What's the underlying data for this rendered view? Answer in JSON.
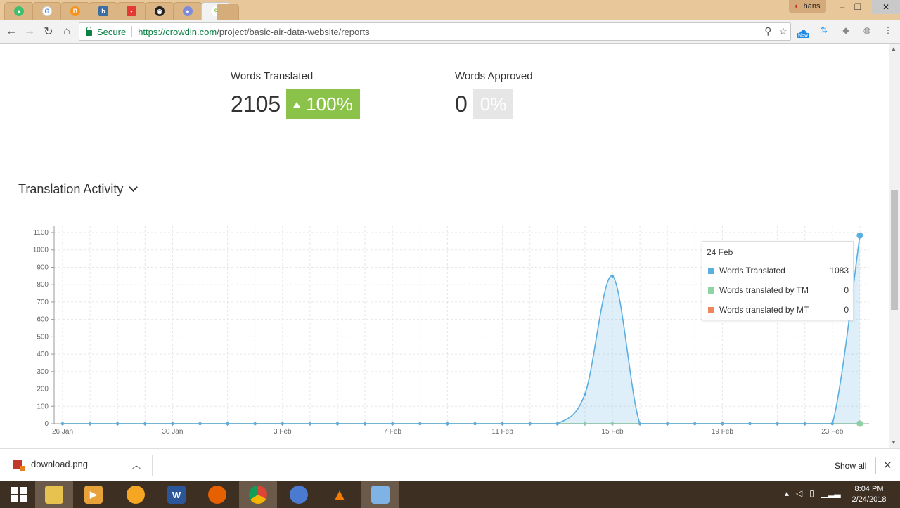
{
  "browser": {
    "profile_name": "hans",
    "address": {
      "secure_label": "Secure",
      "url_host": "https://crowdin.com",
      "url_path": "/project/basic-air-data-website/reports"
    },
    "extension_badge": "New"
  },
  "stats": {
    "translated": {
      "label": "Words Translated",
      "value": "2105",
      "percent": "100%"
    },
    "approved": {
      "label": "Words Approved",
      "value": "0",
      "percent": "0%"
    }
  },
  "section": {
    "title": "Translation Activity"
  },
  "chart_data": {
    "type": "area",
    "x_ticks": [
      "26 Jan",
      "30 Jan",
      "3 Feb",
      "7 Feb",
      "11 Feb",
      "15 Feb",
      "19 Feb",
      "23 Feb"
    ],
    "x": [
      "26 Jan",
      "27 Jan",
      "28 Jan",
      "29 Jan",
      "30 Jan",
      "31 Jan",
      "1 Feb",
      "2 Feb",
      "3 Feb",
      "4 Feb",
      "5 Feb",
      "6 Feb",
      "7 Feb",
      "8 Feb",
      "9 Feb",
      "10 Feb",
      "11 Feb",
      "12 Feb",
      "13 Feb",
      "14 Feb",
      "15 Feb",
      "16 Feb",
      "17 Feb",
      "18 Feb",
      "19 Feb",
      "20 Feb",
      "21 Feb",
      "22 Feb",
      "23 Feb",
      "24 Feb"
    ],
    "ylim": [
      0,
      1100
    ],
    "y_ticks": [
      0,
      100,
      200,
      300,
      400,
      500,
      600,
      700,
      800,
      900,
      1000,
      1100
    ],
    "grid": true,
    "series": [
      {
        "name": "Words Translated",
        "color": "#5aaee0",
        "values": [
          0,
          0,
          0,
          0,
          0,
          0,
          0,
          0,
          0,
          0,
          0,
          0,
          0,
          0,
          0,
          0,
          0,
          0,
          0,
          170,
          850,
          0,
          0,
          0,
          0,
          0,
          0,
          0,
          0,
          1083
        ]
      },
      {
        "name": "Words translated by TM",
        "color": "#8fd4a4",
        "values": [
          0,
          0,
          0,
          0,
          0,
          0,
          0,
          0,
          0,
          0,
          0,
          0,
          0,
          0,
          0,
          0,
          0,
          0,
          0,
          0,
          0,
          0,
          0,
          0,
          0,
          0,
          0,
          0,
          0,
          0
        ]
      },
      {
        "name": "Words translated by MT",
        "color": "#f0845a",
        "values": [
          0,
          0,
          0,
          0,
          0,
          0,
          0,
          0,
          0,
          0,
          0,
          0,
          0,
          0,
          0,
          0,
          0,
          0,
          0,
          0,
          0,
          0,
          0,
          0,
          0,
          0,
          0,
          0,
          0,
          0
        ]
      }
    ]
  },
  "tooltip": {
    "date": "24 Feb",
    "rows": [
      {
        "name": "Words Translated",
        "value": "1083",
        "color": "#5aaee0"
      },
      {
        "name": "Words translated by TM",
        "value": "0",
        "color": "#8fd4a4"
      },
      {
        "name": "Words translated by MT",
        "value": "0",
        "color": "#f0845a"
      }
    ]
  },
  "downloads": {
    "file_name": "download.png",
    "show_all_label": "Show all"
  },
  "taskbar": {
    "time": "8:04 PM",
    "date": "2/24/2018",
    "apps": [
      "windows-start",
      "file-explorer",
      "media-player",
      "vlc-orange",
      "word",
      "firefox",
      "chrome",
      "chromium",
      "vlc",
      "paint"
    ]
  }
}
